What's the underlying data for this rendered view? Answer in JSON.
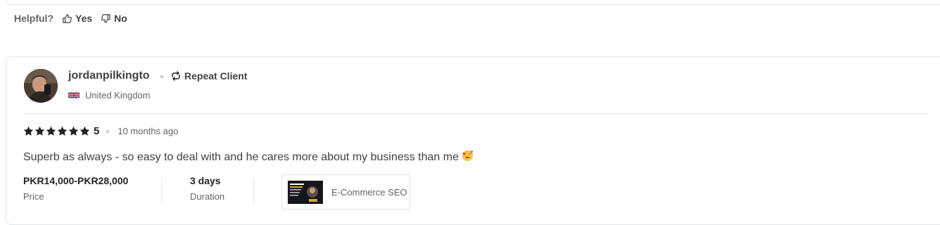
{
  "helpful": {
    "question": "Helpful?",
    "yes_label": "Yes",
    "no_label": "No"
  },
  "review": {
    "username": "jordanpilkingto",
    "badge": "Repeat Client",
    "country": "United Kingdom",
    "rating": "5",
    "rating_fraction": 1.0,
    "time_ago": "10 months ago",
    "text": "Superb as always - so easy to deal with and he cares more about my business than me",
    "emoji": "smiling-face-with-hearts",
    "price": {
      "value": "PKR14,000-PKR28,000",
      "label": "Price"
    },
    "duration": {
      "value": "3 days",
      "label": "Duration"
    },
    "gig": {
      "title": "E-Commerce SEO"
    }
  },
  "colors": {
    "text_primary": "#404145",
    "text_secondary": "#62646a",
    "border": "#e4e5e7",
    "star": "#222325"
  }
}
